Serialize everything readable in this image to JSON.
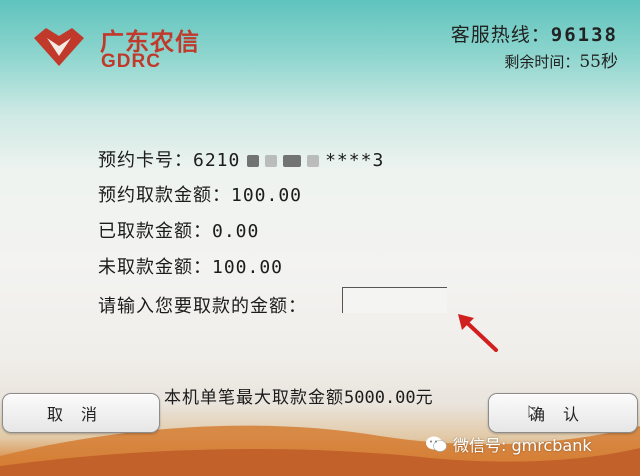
{
  "bank": {
    "name_cn": "广东农信",
    "name_en": "GDRC",
    "brand_color": "#c0392b"
  },
  "header": {
    "hotline_label": "客服热线：",
    "hotline_number": "96138",
    "remaining_label": "剩余时间：",
    "remaining_seconds": "55秒"
  },
  "booking": {
    "card_label": "预约卡号：",
    "card_prefix": "6210",
    "card_masked_tail": "****3",
    "reserved_label": "预约取款金额：",
    "reserved_value": "100.00",
    "withdrawn_label": "已取款金额：",
    "withdrawn_value": "0.00",
    "pending_label": "未取款金额：",
    "pending_value": "100.00"
  },
  "amount_prompt": {
    "label": "请输入您要取款的金额：",
    "value": ""
  },
  "limit": {
    "prefix": "本机单笔最大取款金额",
    "amount": "5000.00",
    "suffix": "元"
  },
  "buttons": {
    "cancel": "取消",
    "confirm": "确认"
  },
  "watermark": {
    "text": "微信号: gmrcbank"
  },
  "icons": [
    "gdrc-logo-icon",
    "pointer-arrow-icon",
    "mouse-cursor-icon",
    "wechat-icon"
  ]
}
